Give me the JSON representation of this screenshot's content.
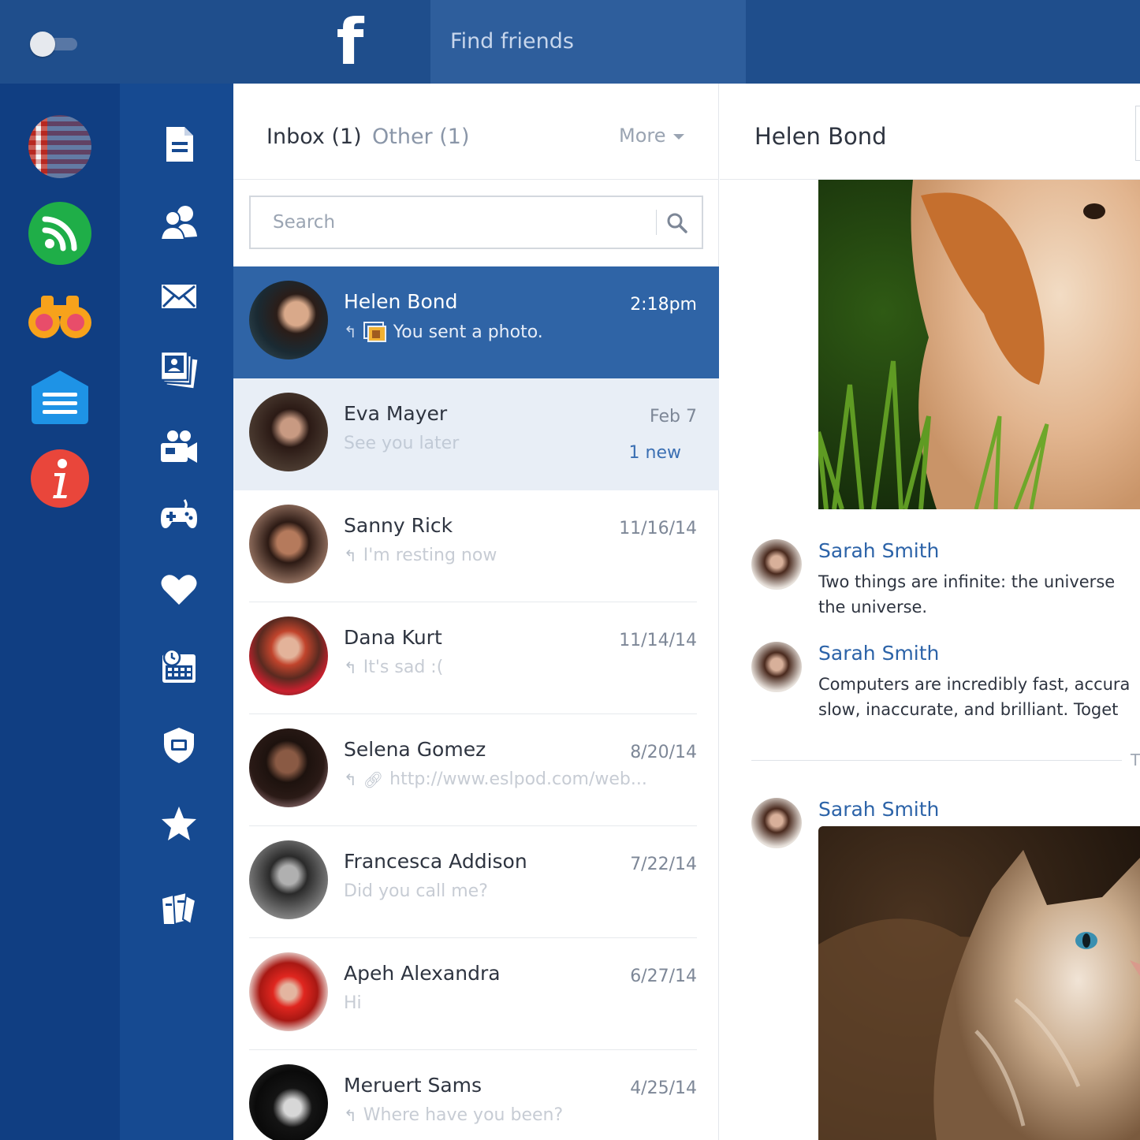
{
  "topbar": {
    "logo_letter": "f",
    "find_friends_label": "Find friends"
  },
  "apps": [
    {
      "icon": "flag-app-icon"
    },
    {
      "icon": "rss-app-icon",
      "color": "#1fae48"
    },
    {
      "icon": "binoculars-app-icon",
      "color": "#f7a21b"
    },
    {
      "icon": "list-app-icon",
      "color": "#1e93e6"
    },
    {
      "icon": "info-app-icon",
      "color": "#e9463b",
      "glyph": "i"
    }
  ],
  "nav": [
    {
      "icon": "document-icon"
    },
    {
      "icon": "friends-icon"
    },
    {
      "icon": "mail-icon"
    },
    {
      "icon": "photos-icon"
    },
    {
      "icon": "video-icon"
    },
    {
      "icon": "gamepad-icon"
    },
    {
      "icon": "heart-icon"
    },
    {
      "icon": "calendar-icon"
    },
    {
      "icon": "shield-icon"
    },
    {
      "icon": "star-icon"
    },
    {
      "icon": "books-icon"
    }
  ],
  "list": {
    "tabs": {
      "inbox": "Inbox  (1)",
      "other": "Other  (1)",
      "more": "More"
    },
    "search_placeholder": "Search",
    "conversations": [
      {
        "name": "Helen Bond",
        "date": "2:18pm",
        "preview": "You sent a photo.",
        "state": "active"
      },
      {
        "name": "Eva Mayer",
        "date": "Feb 7",
        "preview": "See you later",
        "new_count": "1 new",
        "state": "unread"
      },
      {
        "name": "Sanny Rick",
        "date": "11/16/14",
        "preview": "I'm resting now"
      },
      {
        "name": "Dana Kurt",
        "date": "11/14/14",
        "preview": "It's sad :("
      },
      {
        "name": "Selena Gomez",
        "date": "8/20/14",
        "preview": "http://www.eslpod.com/web..."
      },
      {
        "name": "Francesca Addison",
        "date": "7/22/14",
        "preview": "Did you call me?"
      },
      {
        "name": "Apeh Alexandra",
        "date": "6/27/14",
        "preview": "Hi"
      },
      {
        "name": "Meruert Sams",
        "date": "4/25/14",
        "preview": "Where have you been?"
      }
    ]
  },
  "chat": {
    "title": "Helen Bond",
    "messages": [
      {
        "sender": "Sarah Smith",
        "text": "Two things are infinite: the universe\nthe universe."
      },
      {
        "sender": "Sarah Smith",
        "text": "Computers are incredibly fast, accura\nslow, inaccurate, and brilliant. Toget"
      },
      {
        "sender": "Sarah Smith",
        "text": ""
      }
    ],
    "day_separator": "T"
  },
  "colors": {
    "topbar": "#1f4e8c",
    "active_row": "#2f64a6",
    "unread_row": "#e8eef6",
    "sender_link": "#2c63a8"
  }
}
